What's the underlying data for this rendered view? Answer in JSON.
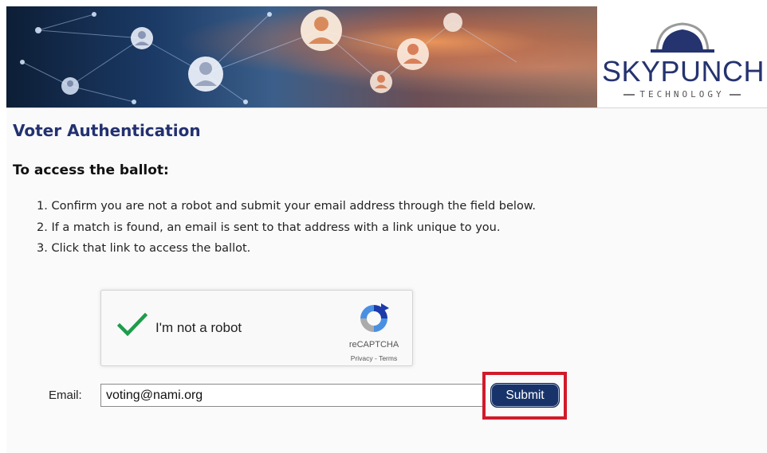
{
  "logo": {
    "name": "SKYPUNCH",
    "tagline": "TECHNOLOGY",
    "brand_color": "#25336f"
  },
  "page": {
    "title": "Voter Authentication",
    "section_heading": "To access the ballot:",
    "steps": [
      "1. Confirm you are not a robot and submit your email address through the field below.",
      "2. If a match is found, an email is sent to that address with a link unique to you.",
      "3. Click that link to access the ballot."
    ]
  },
  "captcha": {
    "label": "I'm not a robot",
    "brand": "reCAPTCHA",
    "privacy": "Privacy",
    "separator": " - ",
    "terms": "Terms",
    "checked": true,
    "check_color": "#1e9c4b"
  },
  "form": {
    "email_label": "Email:",
    "email_value": "voting@nami.org",
    "submit_label": "Submit",
    "submit_color": "#17336a",
    "highlight_color": "#d11a2a"
  }
}
